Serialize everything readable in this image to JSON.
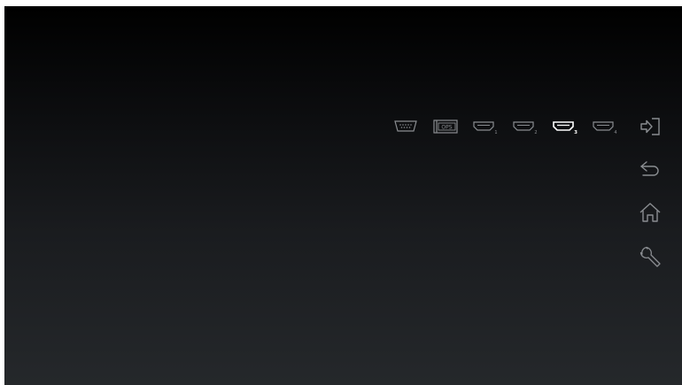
{
  "colors": {
    "icon_inactive": "#8a8d91",
    "icon_active": "#ffffff",
    "background_top": "#000000",
    "background_bottom": "#25282b"
  },
  "sources": [
    {
      "id": "vga",
      "icon": "vga-port-icon",
      "label": "",
      "active": false
    },
    {
      "id": "ops",
      "icon": "ops-slot-icon",
      "label": "OPS",
      "active": false
    },
    {
      "id": "hdmi1",
      "icon": "hdmi-port-icon",
      "label": "1",
      "active": false
    },
    {
      "id": "hdmi2",
      "icon": "hdmi-port-icon",
      "label": "2",
      "active": false
    },
    {
      "id": "hdmi3",
      "icon": "hdmi-port-icon",
      "label": "3",
      "active": true
    },
    {
      "id": "hdmi4",
      "icon": "hdmi-port-icon",
      "label": "4",
      "active": false
    }
  ],
  "side_buttons": [
    {
      "id": "input",
      "icon": "input-source-icon"
    },
    {
      "id": "back",
      "icon": "back-arrow-icon"
    },
    {
      "id": "home",
      "icon": "home-icon"
    },
    {
      "id": "settings",
      "icon": "wrench-icon"
    }
  ]
}
